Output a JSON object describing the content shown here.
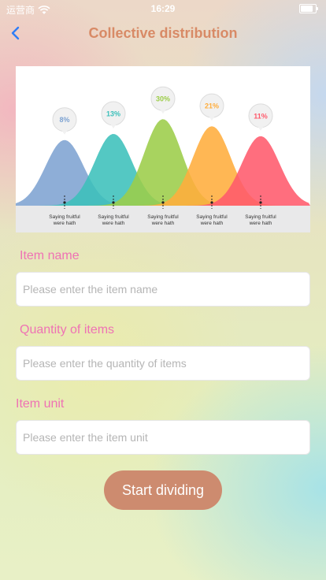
{
  "status_bar": {
    "carrier": "运营商",
    "time": "16:29",
    "battery_level": 0.85
  },
  "nav": {
    "title": "Collective distribution"
  },
  "banner": {
    "chart_data": {
      "type": "area",
      "categories": [
        "Saying fruitful were hath",
        "Saying fruitful were hath",
        "Saying fruitful were hath",
        "Saying fruitful were hath",
        "Saying fruitful were hath"
      ],
      "values": [
        8,
        13,
        30,
        21,
        11
      ],
      "labels": [
        "8%",
        "13%",
        "30%",
        "21%",
        "11%"
      ],
      "colors": [
        "#7ea3d2",
        "#3cc0bb",
        "#9ccd49",
        "#ffad3c",
        "#ff5a6c"
      ]
    }
  },
  "form": {
    "item_name": {
      "label": "Item name",
      "placeholder": "Please enter the item name",
      "value": ""
    },
    "quantity": {
      "label": "Quantity of items",
      "placeholder": "Please enter the quantity of items",
      "value": ""
    },
    "unit": {
      "label": "Item unit",
      "placeholder": "Please enter the item unit",
      "value": ""
    }
  },
  "actions": {
    "start_label": "Start dividing"
  }
}
